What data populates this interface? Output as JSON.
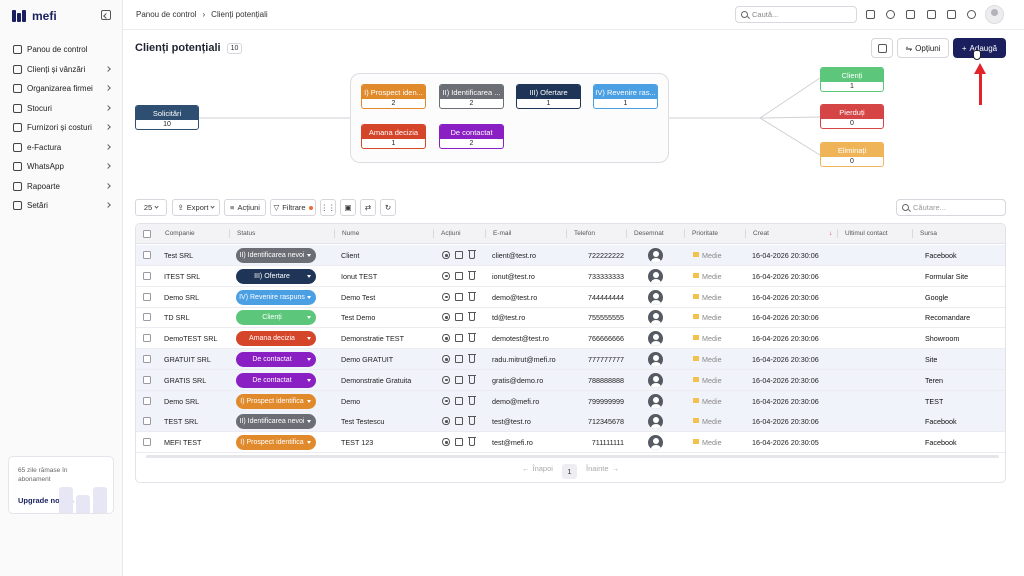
{
  "app": {
    "logo_text": "mefi",
    "colors": {
      "primary": "#1b1f5e",
      "accent_red": "#e0242a"
    }
  },
  "sidebar": {
    "items": [
      {
        "label": "Panou de control",
        "icon": "home-icon",
        "has_children": false
      },
      {
        "label": "Clienți și vânzări",
        "icon": "users-icon",
        "has_children": true
      },
      {
        "label": "Organizarea firmei",
        "icon": "organization-icon",
        "has_children": true
      },
      {
        "label": "Stocuri",
        "icon": "box-icon",
        "has_children": true
      },
      {
        "label": "Furnizori și costuri",
        "icon": "suppliers-icon",
        "has_children": true
      },
      {
        "label": "e-Factura",
        "icon": "cloud-icon",
        "has_children": true
      },
      {
        "label": "WhatsApp",
        "icon": "whatsapp-icon",
        "has_children": true
      },
      {
        "label": "Rapoarte",
        "icon": "clipboard-icon",
        "has_children": true
      },
      {
        "label": "Setări",
        "icon": "gear-icon",
        "has_children": true
      }
    ],
    "promo": {
      "text": "65 zile rămase în abonament",
      "link": "Upgrade now"
    }
  },
  "topbar": {
    "breadcrumb": [
      "Panou de control",
      "Clienți potențiali"
    ],
    "search_placeholder": "Caută...",
    "icons": [
      "plus-square-icon",
      "timer-icon",
      "calendar-icon",
      "checklist-icon",
      "chat-icon",
      "bell-icon",
      "user-avatar-icon"
    ]
  },
  "page": {
    "title": "Clienți potențiali",
    "count": "10",
    "options_label": "Opțiuni",
    "add_label": "Adaugă"
  },
  "pipeline": {
    "source": {
      "label": "Solicitări",
      "count": "10",
      "color": "#2f4f72"
    },
    "stages": [
      {
        "label": "I) Prospect iden...",
        "count": "2",
        "color": "#e08a2c"
      },
      {
        "label": "II) Identificarea ...",
        "count": "2",
        "color": "#6b6f75"
      },
      {
        "label": "III) Ofertare",
        "count": "1",
        "color": "#1e3557"
      },
      {
        "label": "IV) Revenire ras...",
        "count": "1",
        "color": "#4b9fe3"
      },
      {
        "label": "Amana decizia",
        "count": "1",
        "color": "#d4452a"
      },
      {
        "label": "De contactat",
        "count": "2",
        "color": "#8a1fc4"
      }
    ],
    "outcomes": [
      {
        "label": "Clienți",
        "count": "1",
        "color": "#5cc77a"
      },
      {
        "label": "Pierduți",
        "count": "0",
        "color": "#d64545"
      },
      {
        "label": "Eliminați",
        "count": "0",
        "color": "#f0b458"
      }
    ]
  },
  "toolbar": {
    "page_size": "25",
    "export_label": "Export",
    "actions_label": "Acțiuni",
    "filter_label": "Filtrare",
    "search_placeholder": "Căutare..."
  },
  "table": {
    "columns": [
      "Companie",
      "Status",
      "Nume",
      "Acțiuni",
      "E-mail",
      "Telefon",
      "Desemnat",
      "Prioritate",
      "Creat",
      "Ultimul contact",
      "Sursa"
    ],
    "rows": [
      {
        "company": "Test SRL",
        "status": "II) Identificarea nevoi",
        "status_color": "#6b6f75",
        "name": "Client",
        "email": "client@test.ro",
        "phone": "722222222",
        "priority": "Medie",
        "created": "16-04-2026 20:30:06",
        "source": "Facebook",
        "alt": true
      },
      {
        "company": "ITEST SRL",
        "status": "III) Ofertare",
        "status_color": "#1e3557",
        "name": "Ionut TEST",
        "email": "ionut@test.ro",
        "phone": "733333333",
        "priority": "Medie",
        "created": "16-04-2026 20:30:06",
        "source": "Formular Site",
        "alt": false
      },
      {
        "company": "Demo SRL",
        "status": "IV) Revenire raspuns",
        "status_color": "#4b9fe3",
        "name": "Demo Test",
        "email": "demo@test.ro",
        "phone": "744444444",
        "priority": "Medie",
        "created": "16-04-2026 20:30:06",
        "source": "Google",
        "alt": false
      },
      {
        "company": "TD SRL",
        "status": "Clienți",
        "status_color": "#5cc77a",
        "name": "Test Demo",
        "email": "td@test.ro",
        "phone": "755555555",
        "priority": "Medie",
        "created": "16-04-2026 20:30:06",
        "source": "Recomandare",
        "alt": false
      },
      {
        "company": "DemoTEST SRL",
        "status": "Amana decizia",
        "status_color": "#d4452a",
        "name": "Demonstratie TEST",
        "email": "demotest@test.ro",
        "phone": "766666666",
        "priority": "Medie",
        "created": "16-04-2026 20:30:06",
        "source": "Showroom",
        "alt": false
      },
      {
        "company": "GRATUIT SRL",
        "status": "De contactat",
        "status_color": "#8a1fc4",
        "name": "Demo GRATUIT",
        "email": "radu.mitrut@mefi.ro",
        "phone": "777777777",
        "priority": "Medie",
        "created": "16-04-2026 20:30:06",
        "source": "Site",
        "alt": true
      },
      {
        "company": "GRATIS SRL",
        "status": "De contactat",
        "status_color": "#8a1fc4",
        "name": "Demonstratie Gratuita",
        "email": "gratis@demo.ro",
        "phone": "788888888",
        "priority": "Medie",
        "created": "16-04-2026 20:30:06",
        "source": "Teren",
        "alt": true
      },
      {
        "company": "Demo SRL",
        "status": "I) Prospect identifica",
        "status_color": "#e08a2c",
        "name": "Demo",
        "email": "demo@mefi.ro",
        "phone": "799999999",
        "priority": "Medie",
        "created": "16-04-2026 20:30:06",
        "source": "TEST",
        "alt": true
      },
      {
        "company": "TEST SRL",
        "status": "II) Identificarea nevoi",
        "status_color": "#6b6f75",
        "name": "Test Testescu",
        "email": "test@test.ro",
        "phone": "712345678",
        "priority": "Medie",
        "created": "16-04-2026 20:30:06",
        "source": "Facebook",
        "alt": true
      },
      {
        "company": "MEFI TEST",
        "status": "I) Prospect identifica",
        "status_color": "#e08a2c",
        "name": "TEST 123",
        "email": "test@mefi.ro",
        "phone": "711111111",
        "priority": "Medie",
        "created": "16-04-2026 20:30:05",
        "source": "Facebook",
        "alt": false
      }
    ]
  },
  "pagination": {
    "prev_label": "Înapoi",
    "current": "1",
    "next_label": "Înainte"
  }
}
